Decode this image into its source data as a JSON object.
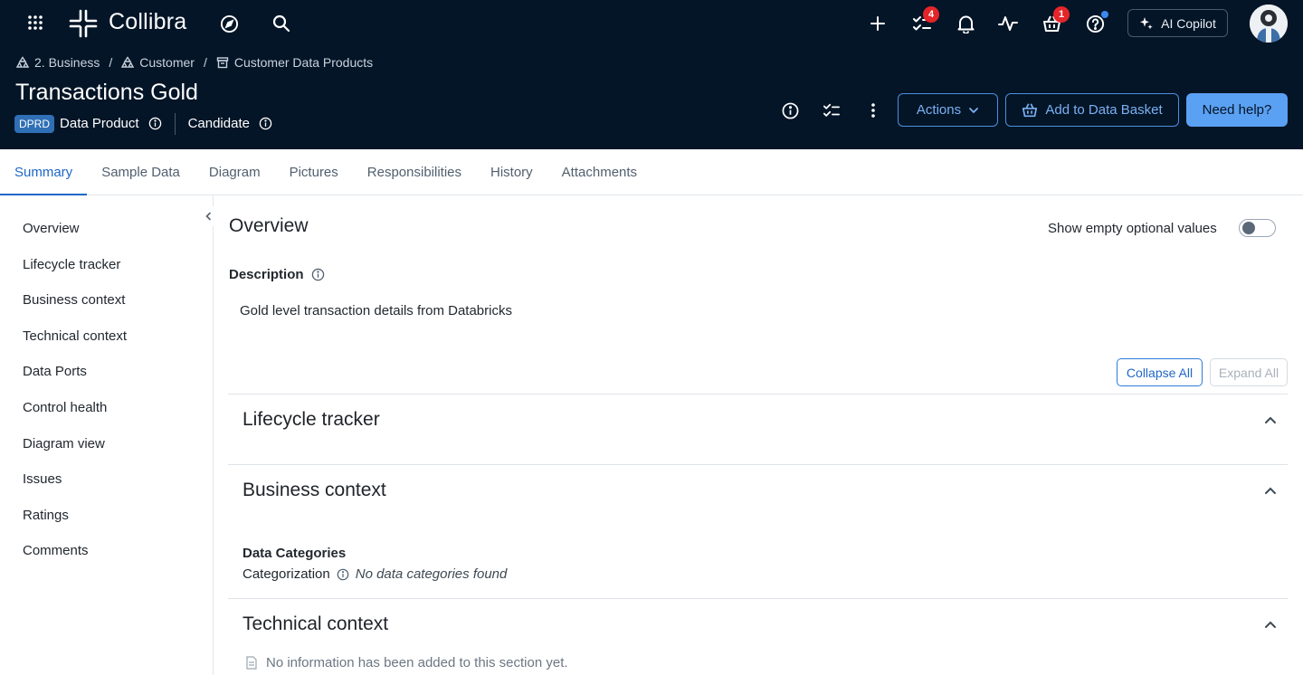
{
  "app": {
    "name": "Collibra"
  },
  "header": {
    "notifications": {
      "tasks_count": "4",
      "basket_count": "1"
    },
    "copilot_label": "AI Copilot"
  },
  "breadcrumb": [
    {
      "label": "2. Business"
    },
    {
      "label": "Customer"
    },
    {
      "label": "Customer Data Products"
    }
  ],
  "asset": {
    "title": "Transactions Gold",
    "type_badge": "DPRD",
    "type_label": "Data Product",
    "status": "Candidate"
  },
  "actions": {
    "actions_label": "Actions",
    "basket_label": "Add to Data Basket",
    "help_label": "Need help?"
  },
  "tabs": [
    {
      "label": "Summary",
      "active": true
    },
    {
      "label": "Sample Data"
    },
    {
      "label": "Diagram"
    },
    {
      "label": "Pictures"
    },
    {
      "label": "Responsibilities"
    },
    {
      "label": "History"
    },
    {
      "label": "Attachments"
    }
  ],
  "sidebar": {
    "items": [
      {
        "label": "Overview"
      },
      {
        "label": "Lifecycle tracker"
      },
      {
        "label": "Business context"
      },
      {
        "label": "Technical context"
      },
      {
        "label": "Data Ports"
      },
      {
        "label": "Control health"
      },
      {
        "label": "Diagram view"
      },
      {
        "label": "Issues"
      },
      {
        "label": "Ratings"
      },
      {
        "label": "Comments"
      }
    ]
  },
  "overview": {
    "title": "Overview",
    "toggle_label": "Show empty optional values",
    "toggle_on": false,
    "description_label": "Description",
    "description_text": "Gold level transaction details from Databricks",
    "collapse_all": "Collapse All",
    "expand_all": "Expand All"
  },
  "sections": {
    "lifecycle": {
      "title": "Lifecycle tracker"
    },
    "business": {
      "title": "Business context",
      "group_label": "Data Categories",
      "field_label": "Categorization",
      "field_value": "No data categories found"
    },
    "technical": {
      "title": "Technical context",
      "empty_note": "No information has been added to this section yet."
    }
  },
  "colors": {
    "header_bg": "#041527",
    "accent": "#1f67c6",
    "primary_button": "#5aa1f3",
    "badge_red": "#e5252a"
  }
}
